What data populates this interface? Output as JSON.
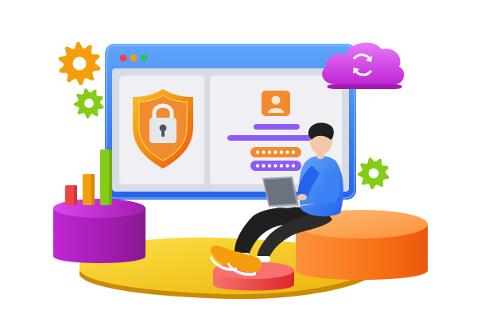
{
  "scene": {
    "window": {
      "traffic_lights": [
        "#ef4444",
        "#f59e0b",
        "#22c55e"
      ],
      "frame_color": "#3b82f6",
      "panel_color": "#efeff4"
    },
    "security_shield": {
      "icon": "shield-lock-icon",
      "color": "#f28a2e"
    },
    "login_form": {
      "avatar_icon": "user-avatar-icon",
      "fields": [
        {
          "type": "text-line",
          "color": "#8b5cf6"
        },
        {
          "type": "text-line",
          "color": "#8b5cf6"
        },
        {
          "type": "password",
          "masked_chars": 7,
          "color": "#f28a2e"
        },
        {
          "type": "password",
          "masked_chars": 7,
          "color": "#8b5cf6"
        }
      ]
    },
    "cloud": {
      "icon": "cloud-sync-icon",
      "color": "#c026d3"
    },
    "gears": [
      {
        "icon": "gear-icon",
        "color": "#f59e0b"
      },
      {
        "icon": "gear-icon",
        "color": "#84cc16"
      },
      {
        "icon": "gear-icon",
        "color": "#84cc16"
      }
    ],
    "bar_chart": {
      "icon": "bar-chart-icon",
      "bars": [
        {
          "level": 0.35,
          "color": "#ef4444"
        },
        {
          "level": 0.55,
          "color": "#f59e0b"
        },
        {
          "level": 1.0,
          "color": "#84cc16"
        }
      ]
    },
    "person": {
      "icon": "person-with-laptop",
      "shirt_color": "#3b82f6",
      "pants_color": "#1f1f1f",
      "shoe_color": "#f59e0b"
    },
    "pedestals": [
      {
        "icon": "cylinder-pedestal",
        "color": "#c026d3"
      },
      {
        "icon": "cylinder-pedestal",
        "color": "#f97316"
      },
      {
        "icon": "cylinder-pedestal",
        "color": "#ef4444"
      }
    ],
    "floor_disc": {
      "color": "#facc15"
    }
  }
}
